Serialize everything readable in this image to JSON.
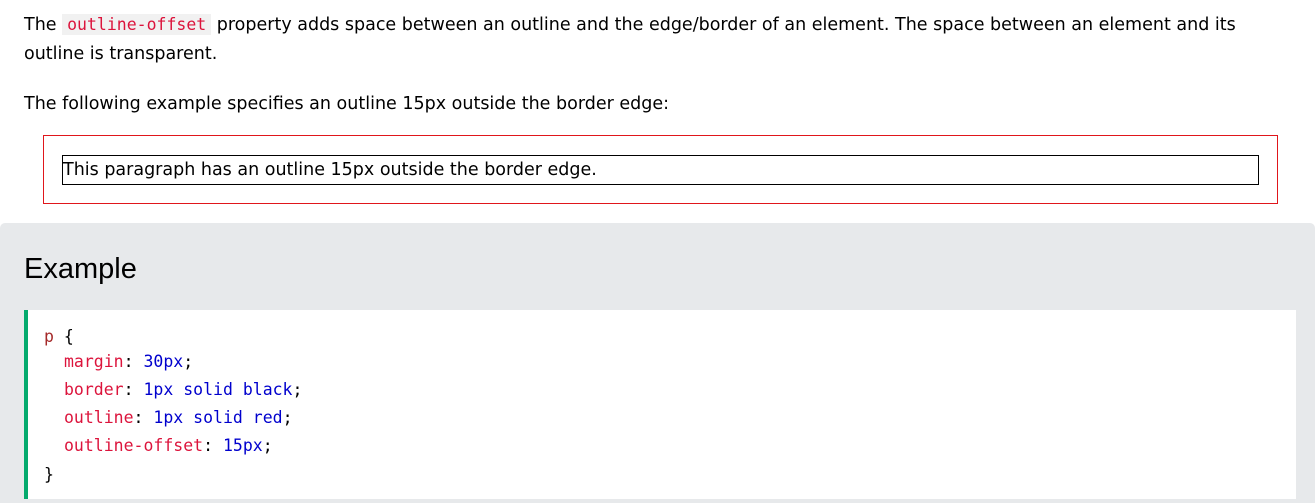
{
  "intro": {
    "part1": "The ",
    "code": "outline-offset",
    "part2": " property adds space between an outline and the edge/border of an element. The space between an element and its outline is transparent."
  },
  "following_text": "The following example specifies an outline 15px outside the border edge:",
  "demo": {
    "paragraph": "This paragraph has an outline 15px outside the border edge."
  },
  "example": {
    "title": "Example",
    "code": {
      "selector": "p",
      "open_brace": "{",
      "close_brace": "}",
      "declarations": [
        {
          "property": "margin",
          "value": "30px"
        },
        {
          "property": "border",
          "value": "1px solid black"
        },
        {
          "property": "outline",
          "value": "1px solid red"
        },
        {
          "property": "outline-offset",
          "value": "15px"
        }
      ]
    }
  },
  "colors": {
    "inline_code_text": "#dc143c",
    "outline_red": "#e0161b",
    "code_accent_green": "#04aa6d",
    "panel_background": "#e7e9eb",
    "code_property": "#dc143c",
    "code_value": "#0000cd"
  }
}
